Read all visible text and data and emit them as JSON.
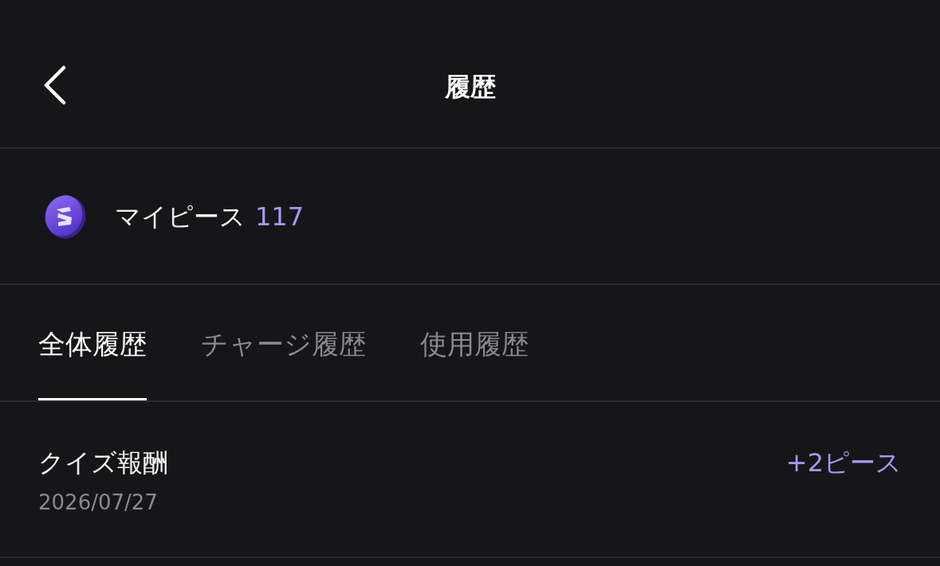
{
  "header": {
    "title": "履歴"
  },
  "balance": {
    "label": "マイピース",
    "value": "117"
  },
  "tabs": [
    {
      "label": "全体履歴",
      "selected": true
    },
    {
      "label": "チャージ履歴",
      "selected": false
    },
    {
      "label": "使用履歴",
      "selected": false
    }
  ],
  "history": [
    {
      "title": "クイズ報酬",
      "date": "2026/07/27",
      "amount": "+2ピース"
    }
  ]
}
